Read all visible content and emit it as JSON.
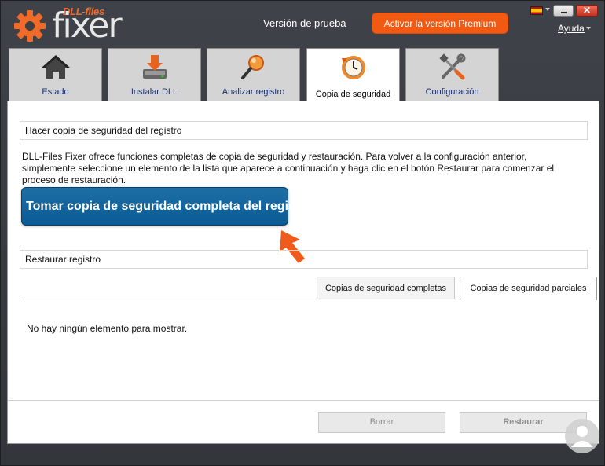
{
  "header": {
    "logo_sub": "DLL-files",
    "logo_main": "fixer",
    "trial_text": "Versión de prueba",
    "activate_label": "Activar la versión Premium",
    "help_label": "Ayuda",
    "close_glyph": "✕"
  },
  "tabs": [
    {
      "label": "Estado",
      "icon": "home-icon"
    },
    {
      "label": "Instalar DLL",
      "icon": "install-icon"
    },
    {
      "label": "Analizar registro",
      "icon": "magnifier-icon"
    },
    {
      "label": "Copia de seguridad",
      "icon": "backup-clock-icon",
      "active": true
    },
    {
      "label": "Configuración",
      "icon": "tools-icon"
    }
  ],
  "backup": {
    "section_title": "Hacer copia de seguridad del registro",
    "description": "DLL-Files Fixer ofrece funciones completas de copia de seguridad y restauración. Para volver a la configuración anterior, simplemente seleccione un elemento de la lista que aparece a continuación y haga clic en el botón Restaurar para comenzar el proceso de restauración.",
    "button_label": "Tomar copia de seguridad completa del registro"
  },
  "restore": {
    "section_title": "Restaurar registro",
    "sub_tabs": [
      {
        "label": "Copias de seguridad completas"
      },
      {
        "label": "Copias de seguridad parciales",
        "active": true
      }
    ],
    "empty_message": "No hay ningún elemento para mostrar.",
    "delete_label": "Borrar",
    "restore_label": "Restaurar"
  },
  "colors": {
    "accent_orange": "#f25a13",
    "button_blue": "#0d5f98",
    "frame_dark": "#3a3d42"
  }
}
